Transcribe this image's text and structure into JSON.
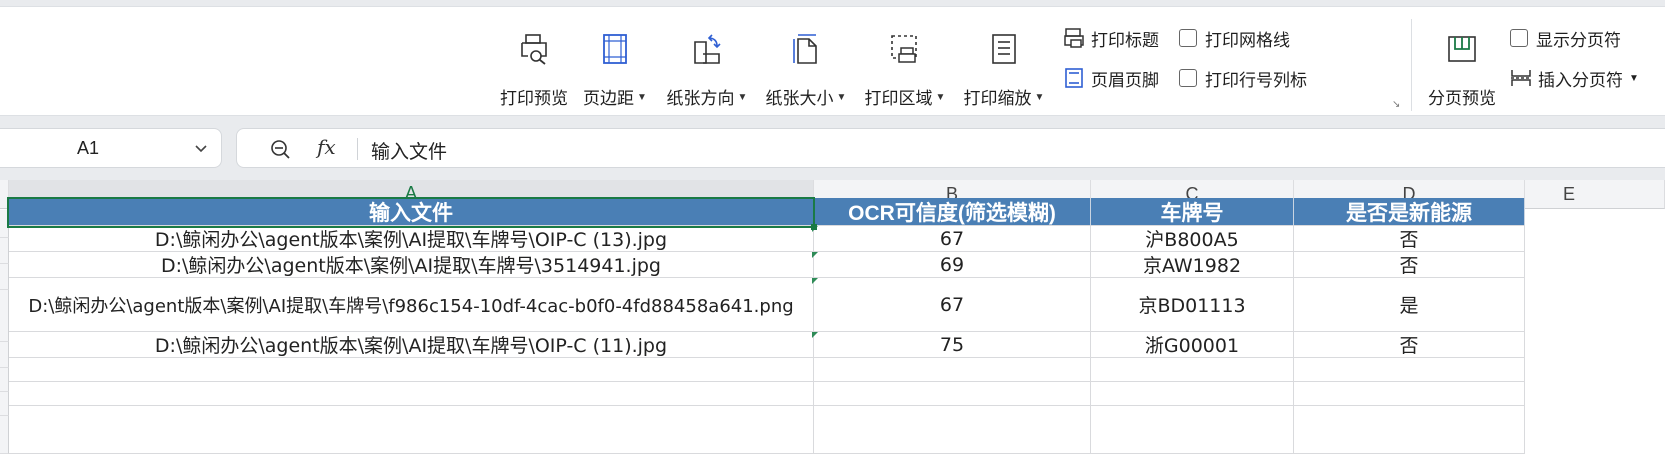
{
  "ribbon": {
    "print_preview": "打印预览",
    "margins": "页边距",
    "orientation": "纸张方向",
    "paper_size": "纸张大小",
    "print_area": "打印区域",
    "print_scale": "打印缩放",
    "print_titles": "打印标题",
    "header_footer": "页眉页脚",
    "print_gridlines": "打印网格线",
    "print_row_col_labels": "打印行号列标",
    "page_break_preview": "分页预览",
    "show_page_breaks": "显示分页符",
    "insert_page_break": "插入分页符"
  },
  "formula_bar": {
    "name_box": "A1",
    "content": "输入文件"
  },
  "columns": [
    "A",
    "B",
    "C",
    "D",
    "E"
  ],
  "table": {
    "headers": [
      "输入文件",
      "OCR可信度(筛选模糊)",
      "车牌号",
      "是否是新能源"
    ],
    "rows": [
      [
        "D:\\鲸闲办公\\agent版本\\案例\\AI提取\\车牌号\\OIP-C (13).jpg",
        "67",
        "沪B800A5",
        "否"
      ],
      [
        "D:\\鲸闲办公\\agent版本\\案例\\AI提取\\车牌号\\3514941.jpg",
        "69",
        "京AW1982",
        "否"
      ],
      [
        "D:\\鲸闲办公\\agent版本\\案例\\AI提取\\车牌号\\f986c154-10df-4cac-b0f0-4fd88458a641.png",
        "67",
        "京BD01113",
        "是"
      ],
      [
        "D:\\鲸闲办公\\agent版本\\案例\\AI提取\\车牌号\\OIP-C (11).jpg",
        "75",
        "浙G00001",
        "否"
      ]
    ]
  },
  "colors": {
    "header_fill": "#4a7fb5",
    "selection": "#1a7a45"
  }
}
